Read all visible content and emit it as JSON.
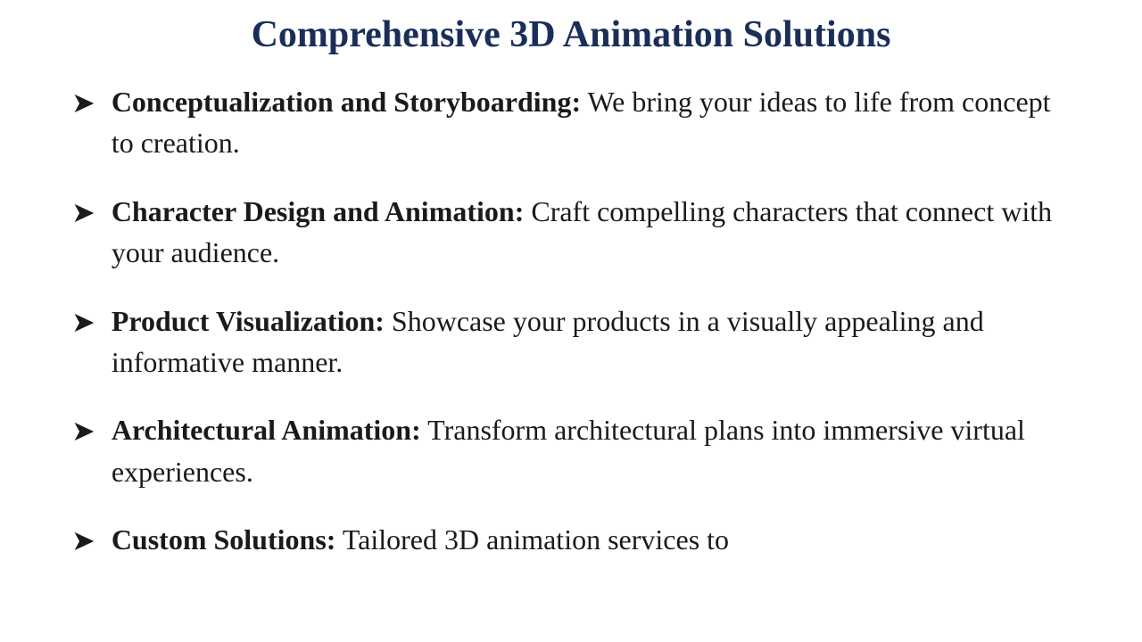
{
  "page": {
    "title": "Comprehensive 3D Animation Solutions",
    "title_color": "#1a2e5a",
    "background_color": "#ffffff"
  },
  "bullets": [
    {
      "id": "item-1",
      "label": "Conceptualization and Storyboarding:",
      "text": " We bring your ideas to life from concept to creation."
    },
    {
      "id": "item-2",
      "label": "Character Design and Animation:",
      "text": " Craft compelling characters that connect with your audience."
    },
    {
      "id": "item-3",
      "label": "Product Visualization:",
      "text": " Showcase your products in a visually appealing and informative manner."
    },
    {
      "id": "item-4",
      "label": "Architectural Animation:",
      "text": " Transform architectural plans into immersive virtual experiences."
    },
    {
      "id": "item-5",
      "label": "Custom Solutions:",
      "text": " Tailored 3D animation services to"
    }
  ],
  "arrow_symbol": "➤"
}
